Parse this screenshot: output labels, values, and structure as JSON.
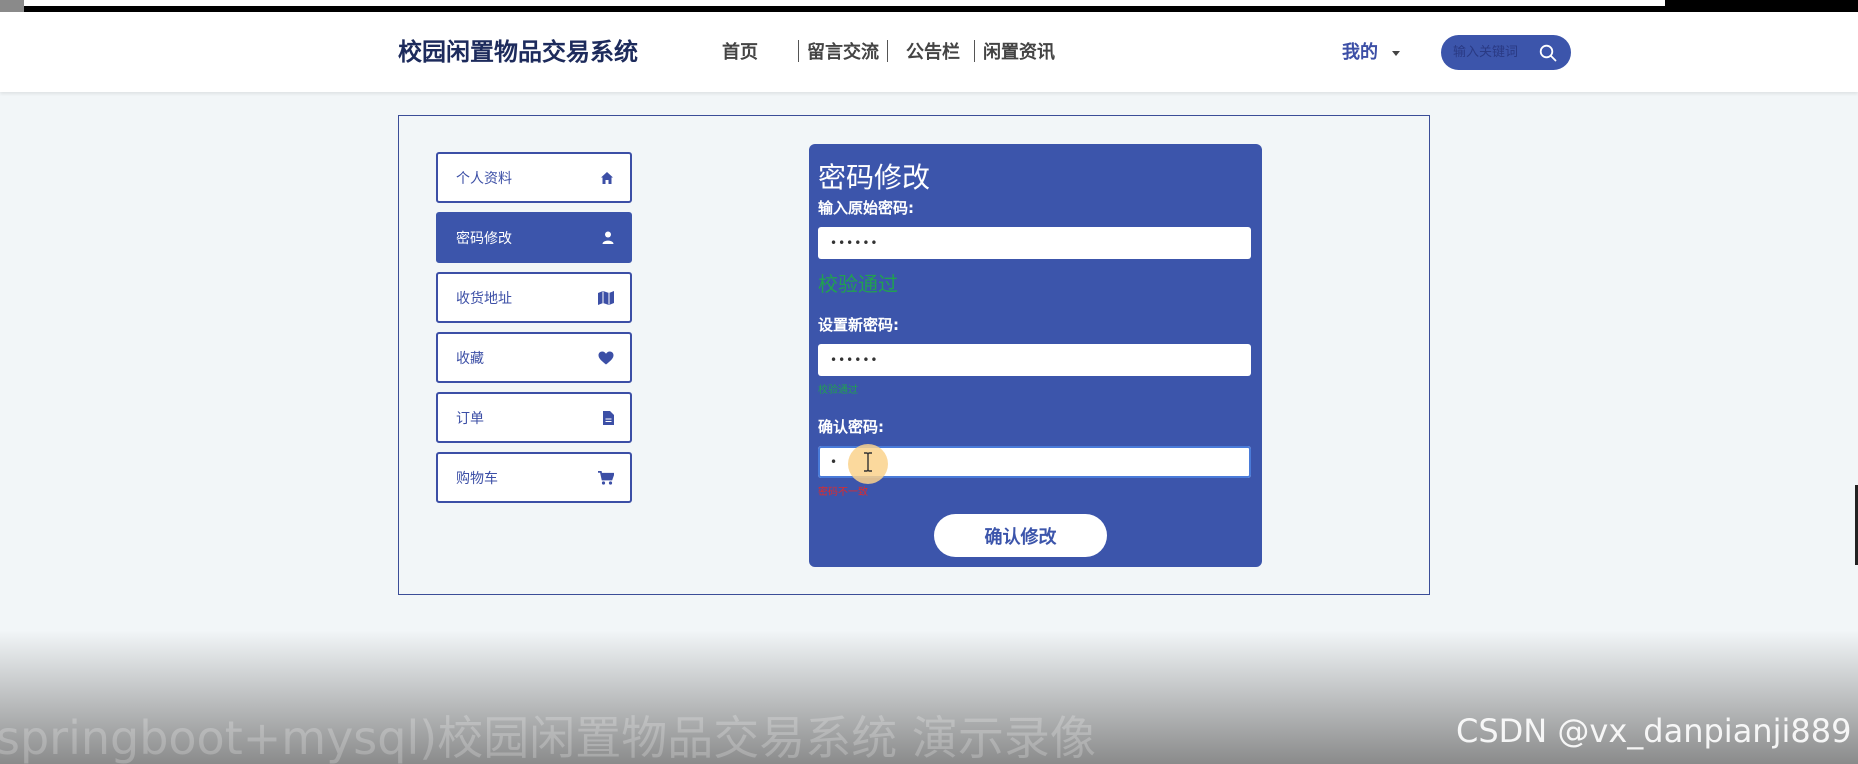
{
  "header": {
    "brand": "校园闲置物品交易系统",
    "nav": [
      "首页",
      "留言交流",
      "公告栏",
      "闲置资讯"
    ],
    "mine": "我的",
    "search_placeholder": "输入关键词"
  },
  "sidebar": {
    "items": [
      {
        "label": "个人资料",
        "icon": "home-icon",
        "active": false
      },
      {
        "label": "密码修改",
        "icon": "user-icon",
        "active": true
      },
      {
        "label": "收货地址",
        "icon": "map-icon",
        "active": false
      },
      {
        "label": "收藏",
        "icon": "heart-icon",
        "active": false
      },
      {
        "label": "订单",
        "icon": "file-icon",
        "active": false
      },
      {
        "label": "购物车",
        "icon": "cart-icon",
        "active": false
      }
    ]
  },
  "form": {
    "title": "密码修改",
    "old_label": "输入原始密码:",
    "old_value": "••••••",
    "old_status": "校验通过",
    "new_label": "设置新密码:",
    "new_value": "••••••",
    "new_status": "校验通过",
    "confirm_label": "确认密码:",
    "confirm_value": "•",
    "confirm_status": "密码不一致",
    "submit": "确认修改"
  },
  "overlay": {
    "caption": "springboot+mysql)校园闲置物品交易系统 演示录像",
    "watermark": "CSDN @vx_danpianji889"
  },
  "colors": {
    "accent": "#3c55ab",
    "success": "#21a150",
    "error": "#e02a2a"
  }
}
